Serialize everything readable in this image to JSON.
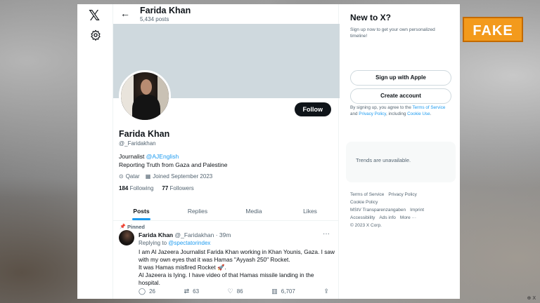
{
  "header": {
    "name": "Farida Khan",
    "posts_count": "5,434 posts",
    "back_icon": "arrow-left-icon"
  },
  "rail": {
    "logo": "𝕏",
    "settings_icon": "gear-icon"
  },
  "profile": {
    "name": "Farida Khan",
    "handle": "@_Faridakhan",
    "follow_label": "Follow",
    "bio_prefix": "Journalist ",
    "bio_link": "@AJEnglish",
    "bio_line2": "Reporting Truth from Gaza and Palestine",
    "location": "Qatar",
    "joined": "Joined September 2023",
    "following_count": "184",
    "following_label": "Following",
    "followers_count": "77",
    "followers_label": "Followers"
  },
  "tabs": [
    {
      "label": "Posts",
      "active": true
    },
    {
      "label": "Replies",
      "active": false
    },
    {
      "label": "Media",
      "active": false
    },
    {
      "label": "Likes",
      "active": false
    }
  ],
  "tweet": {
    "pinned_label": "Pinned",
    "author": "Farida Khan",
    "handle_time": "@_Faridakhan · 39m",
    "replying_prefix": "Replying to ",
    "replying_to": "@spectatorindex",
    "body_line1": "I am Al Jazeera Journalist Farida Khan working in Khan Younis, Gaza. I saw",
    "body_line2": "with my own eyes that it was Hamas \"Ayyash 250\" Rocket.",
    "body_line3": "It was Hamas misfired Rocket 🚀.",
    "body_line4": "Al Jazeera is lying. I have video of that Hamas missile landing in the",
    "body_line5": "hospital.",
    "replies": "26",
    "reposts": "63",
    "likes": "86",
    "views": "6,707"
  },
  "sidebar": {
    "title": "New to X?",
    "subtitle": "Sign up now to get your own personalized timeline!",
    "apple_button": "Sign up with Apple",
    "create_button": "Create account",
    "terms_prefix": "By signing up, you agree to the ",
    "terms_link": "Terms of Service",
    "terms_and": " and ",
    "privacy_link": "Privacy Policy",
    "terms_mid": ", including ",
    "cookie_link": "Cookie Use",
    "terms_end": ".",
    "trends_text": "Trends are unavailable.",
    "footer_links": [
      "Terms of Service",
      "Privacy Policy",
      "Cookie Policy",
      "MStV Transparenzangaben",
      "Imprint",
      "Accessibility",
      "Ads info",
      "More ···",
      "© 2023 X Corp."
    ]
  },
  "overlay": {
    "stamp": "FAKE",
    "credit": "⊕ X",
    "stamp_color": "#f39a1c"
  }
}
